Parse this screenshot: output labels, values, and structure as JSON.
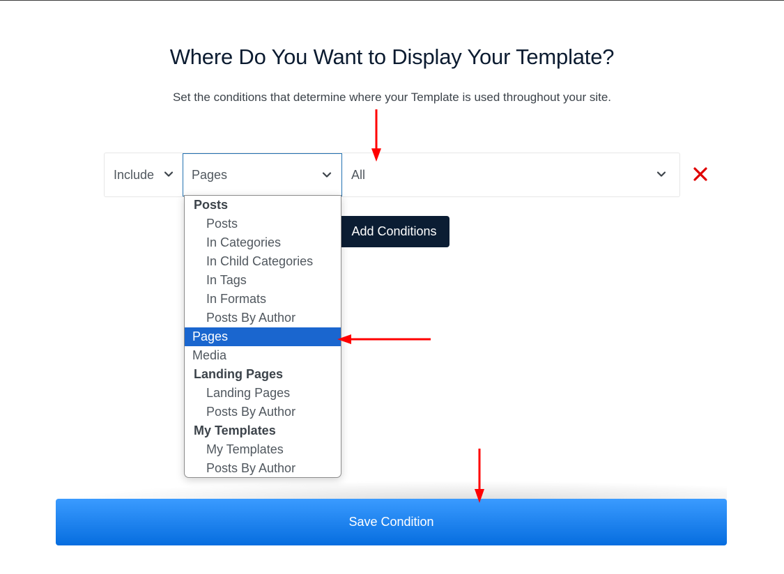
{
  "page": {
    "title": "Where Do You Want to Display Your Template?",
    "subtitle": "Set the conditions that determine where your Template is used throughout your site."
  },
  "condition": {
    "include_value": "Include",
    "type_value": "Pages",
    "rule_value": "All"
  },
  "dropdown": {
    "options": [
      {
        "label": "Posts",
        "kind": "group"
      },
      {
        "label": "Posts",
        "kind": "child"
      },
      {
        "label": "In Categories",
        "kind": "child"
      },
      {
        "label": "In Child Categories",
        "kind": "child"
      },
      {
        "label": "In Tags",
        "kind": "child"
      },
      {
        "label": "In Formats",
        "kind": "child"
      },
      {
        "label": "Posts By Author",
        "kind": "child"
      },
      {
        "label": "Pages",
        "kind": "top",
        "selected": true
      },
      {
        "label": "Media",
        "kind": "top"
      },
      {
        "label": "Landing Pages",
        "kind": "group"
      },
      {
        "label": "Landing Pages",
        "kind": "child"
      },
      {
        "label": "Posts By Author",
        "kind": "child"
      },
      {
        "label": "My Templates",
        "kind": "group"
      },
      {
        "label": "My Templates",
        "kind": "child"
      },
      {
        "label": "Posts By Author",
        "kind": "child"
      }
    ]
  },
  "buttons": {
    "add_conditions": "Add Conditions",
    "save_condition": "Save Condition"
  },
  "colors": {
    "accent": "#2271b1",
    "selected_option": "#1a66cf",
    "remove": "#e00000",
    "annotation_arrow": "#ff0000",
    "save_button_top": "#3a9bff",
    "save_button_bottom": "#066ddf",
    "add_button": "#0b1d33"
  }
}
